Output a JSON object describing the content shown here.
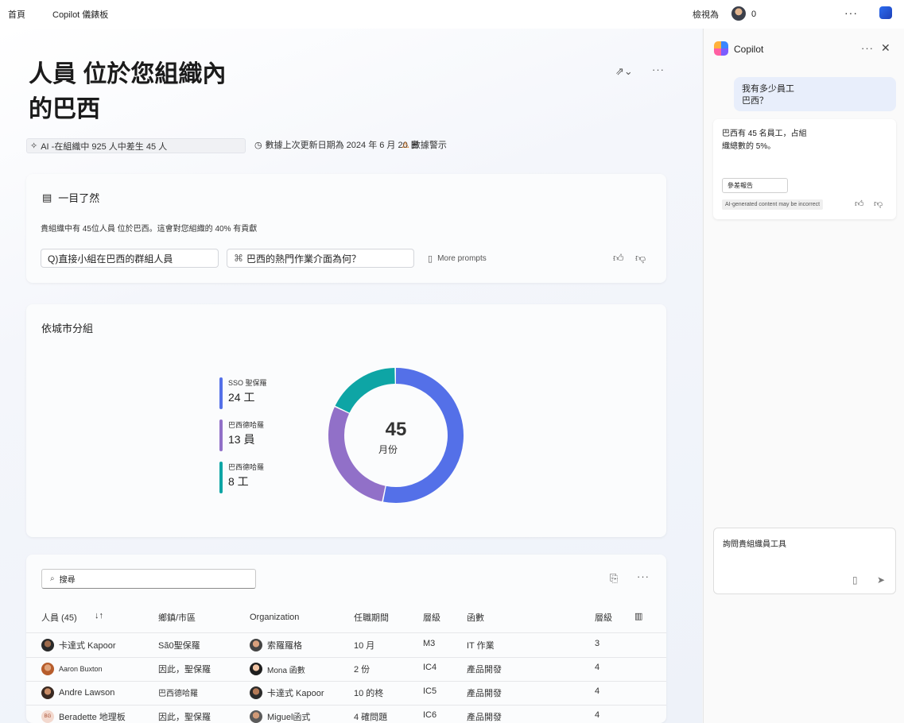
{
  "topbar": {
    "home": "首頁",
    "copilot_dashboard": "Copilot 儀錶板",
    "view_as": "檢視為",
    "count": "0",
    "more": "···"
  },
  "page": {
    "title_line1": "人員 位於您組織內",
    "title_line2": "的巴西",
    "share_icon": "⇗⌄",
    "more": "···"
  },
  "meta": {
    "ai_note": "AI -在組織中 925 人中差生 45 人",
    "updated": "數據上次更新日期為 2024 年 6 月 20 日",
    "warning": "數據警示"
  },
  "summary": {
    "heading": "一目了然",
    "description": "貴組織中有 45位人員 位於巴西。這會對您組織的  40% 有貢獻",
    "prompt1": "Q)直接小組在巴西的群組人員",
    "prompt2": "巴西的熱門作業介面為何？",
    "more_prompts": "More prompts"
  },
  "city": {
    "heading": "依城市分組",
    "total": "45",
    "center_label": "月份",
    "legend": [
      {
        "name": "SSO 聖保羅",
        "value_text": "24 工",
        "color": "#5470e8"
      },
      {
        "name": "巴西德哈羅",
        "value_text": "13 員",
        "color": "#9170c8"
      },
      {
        "name": "巴西德哈羅",
        "value_text": "8 工",
        "color": "#0ea5a5"
      }
    ]
  },
  "chart_data": {
    "type": "pie",
    "categories": [
      "SSO 聖保羅",
      "巴西德哈羅",
      "巴西德哈羅"
    ],
    "values": [
      24,
      13,
      8
    ],
    "colors": [
      "#5470e8",
      "#9170c8",
      "#0ea5a5"
    ],
    "total": 45
  },
  "table": {
    "search_placeholder": "搜尋",
    "headers": [
      "人員 (45)",
      "鄉鎮/市區",
      "Organization",
      "任職期間",
      "層級",
      "函數",
      "層級"
    ],
    "rows": [
      [
        "卡達式 Kapoor",
        "Sã0聖保羅",
        "索羅羅格",
        "10 月",
        "M3",
        "IT 作業",
        "3"
      ],
      [
        "Aaron Buxton",
        "因此，聖保羅",
        "Mona 函數",
        "2 份",
        "IC4",
        "產品開發",
        "4"
      ],
      [
        "Andre Lawson",
        "巴西德哈羅",
        "卡達式 Kapoor",
        "10 的柊",
        "IC5",
        "產品開發",
        "4"
      ],
      [
        "Beradette 地理板",
        "因此，聖保羅",
        "Miguel函式",
        "4 確問題",
        "IC6",
        "產品開發",
        "4"
      ]
    ],
    "initials_row4": "BG"
  },
  "copilot": {
    "title": "Copilot",
    "user_message": "我有多少員工\n巴西？",
    "answer": "巴西有 45 名員工，占組織總數的 5%。",
    "reference": "參差報告",
    "disclaimer": "AI-generated content may be incorrect",
    "compose_text": "詢問貴組織員工具"
  }
}
